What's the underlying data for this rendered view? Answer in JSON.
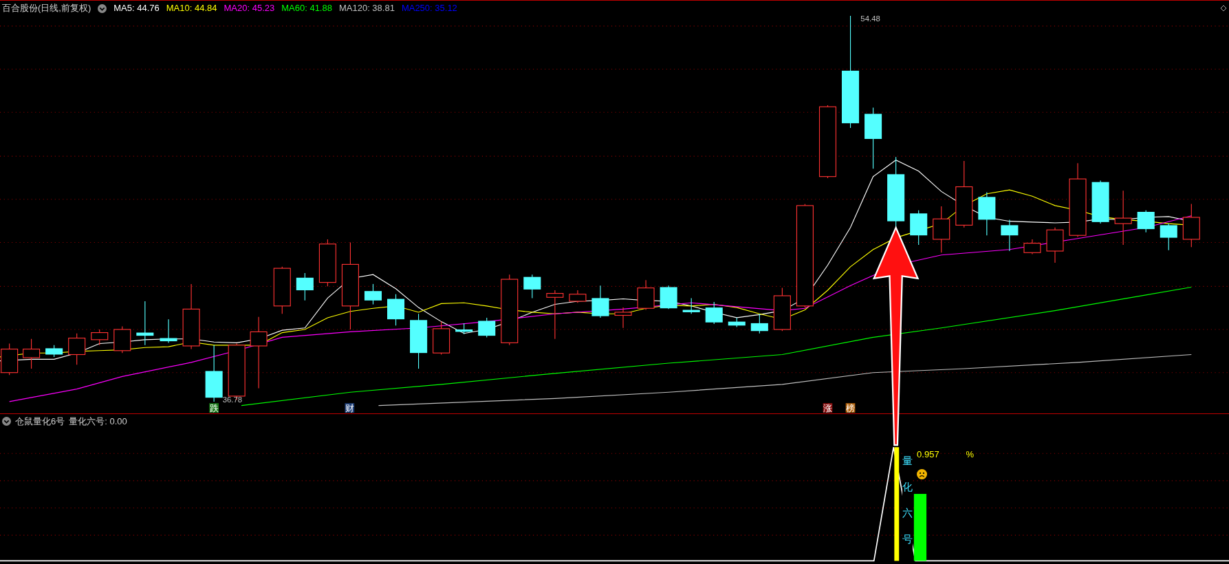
{
  "chart": {
    "title": "百合股份(日线,前复权)",
    "ma": [
      {
        "label": "MA5: 44.76",
        "color": "#ffffff"
      },
      {
        "label": "MA10: 44.84",
        "color": "#ffff00"
      },
      {
        "label": "MA20: 45.23",
        "color": "#ff00ff"
      },
      {
        "label": "MA60: 41.88",
        "color": "#00ff00"
      },
      {
        "label": "MA120: 38.81",
        "color": "#c0c0c0"
      },
      {
        "label": "MA250: 35.12",
        "color": "#0000ff"
      }
    ],
    "high_label": "54.48",
    "low_label": "36.78",
    "markers": [
      {
        "text": "跌",
        "color": "#1a7a1a"
      },
      {
        "text": "财",
        "color": "#1e3f78"
      },
      {
        "text": "涨",
        "color": "#8a1010"
      },
      {
        "text": "榜",
        "color": "#b0600a"
      }
    ]
  },
  "indicator": {
    "name": "仓鼠量化6号",
    "reading": "量化六号: 0.00",
    "vertical_label": "量化六号",
    "value": "0.957",
    "unit": "%"
  }
}
